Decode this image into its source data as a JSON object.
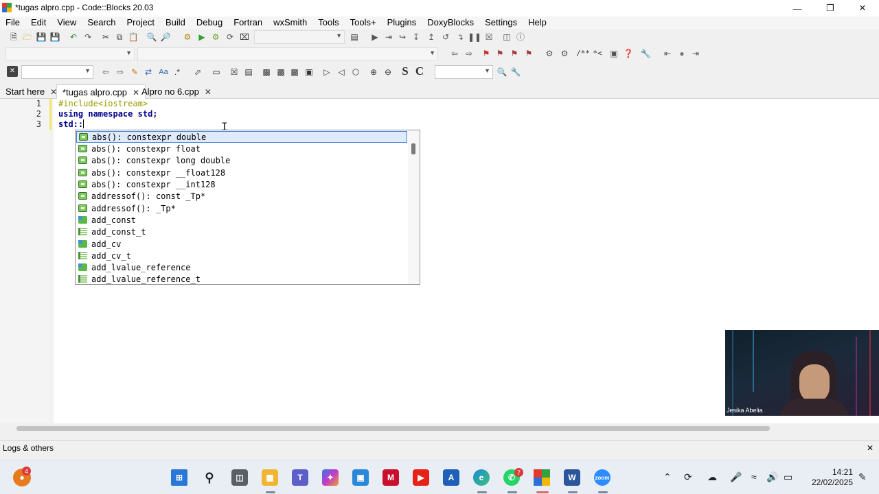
{
  "window": {
    "title": "*tugas alpro.cpp - Code::Blocks 20.03"
  },
  "menu": [
    "File",
    "Edit",
    "View",
    "Search",
    "Project",
    "Build",
    "Debug",
    "Fortran",
    "wxSmith",
    "Tools",
    "Tools+",
    "Plugins",
    "DoxyBlocks",
    "Settings",
    "Help"
  ],
  "toolbar": {
    "doxy_comment": "/**",
    "doxy_inline": "*<",
    "s_label": "S",
    "c_label": "C",
    "regex_label": ".*",
    "match_label": "Aa"
  },
  "tabs": [
    {
      "label": "Start here"
    },
    {
      "label": "*tugas alpro.cpp"
    },
    {
      "label": "Alpro no 6.cpp"
    }
  ],
  "editor": {
    "line_numbers": [
      "1",
      "2",
      "3"
    ],
    "line1": "#include<iostream>",
    "line2_kw1": "using",
    "line2_kw2": "namespace",
    "line2_kw3": "std;",
    "line3": "std::"
  },
  "autocomplete": {
    "items": [
      {
        "label": "abs(): constexpr double",
        "icon": "function-icon",
        "selected": true
      },
      {
        "label": "abs(): constexpr float",
        "icon": "function-icon"
      },
      {
        "label": "abs(): constexpr long double",
        "icon": "function-icon"
      },
      {
        "label": "abs(): constexpr __float128",
        "icon": "function-icon"
      },
      {
        "label": "abs(): constexpr __int128",
        "icon": "function-icon"
      },
      {
        "label": "addressof(): const _Tp*",
        "icon": "function-icon"
      },
      {
        "label": "addressof(): _Tp*",
        "icon": "function-icon"
      },
      {
        "label": "add_const",
        "icon": "class-icon"
      },
      {
        "label": "add_const_t",
        "icon": "typedef-icon"
      },
      {
        "label": "add_cv",
        "icon": "class-icon"
      },
      {
        "label": "add_cv_t",
        "icon": "typedef-icon"
      },
      {
        "label": "add_lvalue_reference",
        "icon": "class-icon"
      },
      {
        "label": "add_lvalue_reference_t",
        "icon": "typedef-icon"
      }
    ]
  },
  "logs": {
    "label": "Logs & others"
  },
  "webcam": {
    "name": "Jesika Abelia"
  },
  "taskbar": {
    "badge_profile": "4",
    "badge_whatsapp": "7",
    "zoom_label": "zoom",
    "time": "14:21",
    "date": "22/02/2025"
  },
  "colors": {
    "keyword": "#00008b",
    "preprocessor": "#9a9a00",
    "selection_border": "#3a7ad8",
    "selection_bg": "#dfeafb"
  }
}
